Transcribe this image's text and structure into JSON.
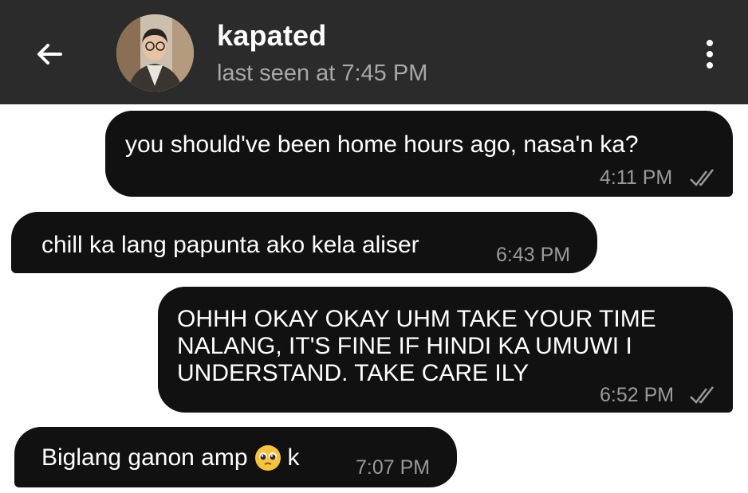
{
  "header": {
    "contact_name": "kapated",
    "last_seen": "last seen at 7:45 PM",
    "back_icon": "arrow-left-icon",
    "menu_icon": "more-vertical-icon",
    "avatar_icon": "contact-avatar"
  },
  "messages": [
    {
      "direction": "out",
      "text": "you should've been home hours ago, nasa'n ka?",
      "time": "4:11 PM",
      "status": "read"
    },
    {
      "direction": "in",
      "text": "chill ka lang papunta ako kela aliser",
      "time": "6:43 PM"
    },
    {
      "direction": "out",
      "text_lines": [
        "OHHH OKAY OKAY UHM TAKE YOUR TIME",
        "NALANG, IT'S FINE IF HINDI KA UMUWI I",
        "UNDERSTAND. TAKE CARE ILY"
      ],
      "time": "6:52 PM",
      "status": "read"
    },
    {
      "direction": "in",
      "text_before": "Biglang ganon amp",
      "emoji": "pleading-face-icon",
      "text_after": "k",
      "time": "7:07 PM"
    }
  ],
  "colors": {
    "header_bg": "#2b2b2b",
    "bubble_bg": "#111111",
    "chat_bg": "#ffffff",
    "timestamp": "#9a9a9a"
  }
}
